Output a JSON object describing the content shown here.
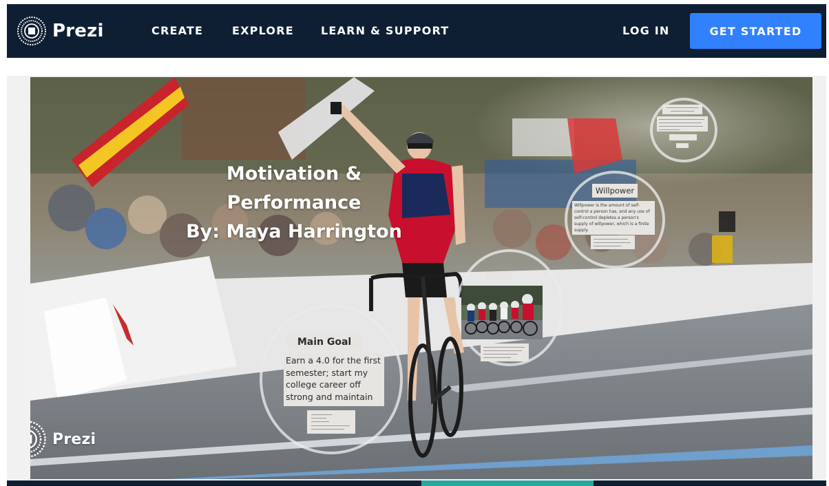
{
  "header": {
    "logo_text": "Prezi",
    "nav": [
      {
        "label": "CREATE"
      },
      {
        "label": "EXPLORE"
      },
      {
        "label": "LEARN & SUPPORT"
      }
    ],
    "login_label": "LOG IN",
    "cta_label": "GET STARTED"
  },
  "presentation": {
    "title_lines": [
      "Motivation &",
      "Performance",
      "By: Maya Harrington"
    ],
    "main_goal": {
      "label": "Main Goal",
      "text": "Earn a 4.0 for the first semester; start my college career off strong and maintain"
    },
    "willpower": {
      "label": "Willpower",
      "text": "Willpower is the amount of self-control a person has, and any use of self-control depletes a person's supply of willpower, which is a finite supply."
    },
    "watermark_text": "Prezi"
  },
  "colors": {
    "nav_bg": "#0f1f33",
    "cta_bg": "#3181ff",
    "accent": "#27a9a0"
  },
  "icons": {
    "logo": "prezi-logo-icon"
  }
}
